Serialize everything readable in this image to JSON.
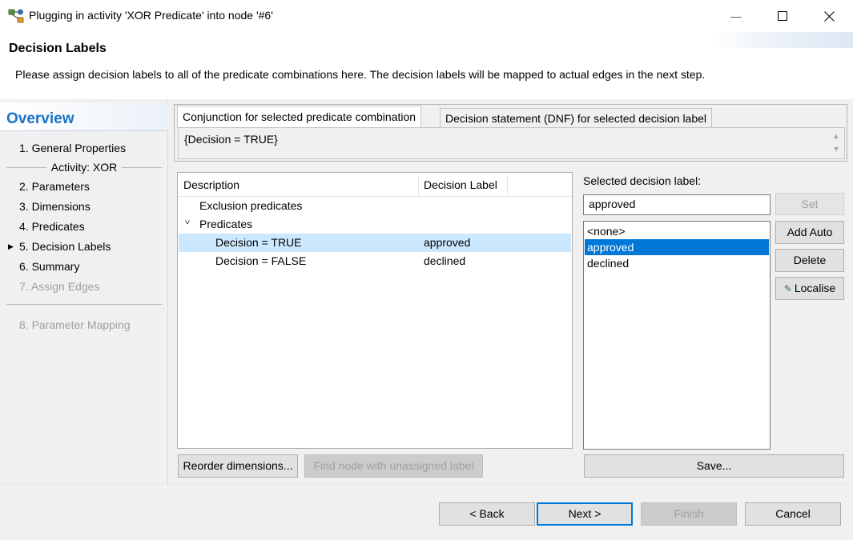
{
  "window": {
    "title": "Plugging in activity 'XOR Predicate' into node '#6'",
    "icon": "workflow-node-icon",
    "minimize_glyph": "—",
    "maximize_glyph": "☐",
    "close_glyph": "✕"
  },
  "header": {
    "title": "Decision Labels",
    "description": "Please assign decision labels to all of the predicate combinations here. The decision labels will be mapped to actual edges in the next step."
  },
  "overview": {
    "title": "Overview",
    "items": [
      {
        "label": "1.  General Properties",
        "enabled": true
      },
      {
        "label": "2.  Parameters",
        "enabled": true
      },
      {
        "label": "3.  Dimensions",
        "enabled": true
      },
      {
        "label": "4.  Predicates",
        "enabled": true
      },
      {
        "label": "5.  Decision Labels",
        "enabled": true,
        "current": true
      },
      {
        "label": "6.  Summary",
        "enabled": true
      },
      {
        "label": "7.  Assign Edges",
        "enabled": false
      },
      {
        "label": "8.  Parameter Mapping",
        "enabled": false
      }
    ],
    "activity_group": "Activity: XOR",
    "current_marker": "▶"
  },
  "tabs": {
    "items": [
      {
        "label": "Conjunction for selected predicate combination",
        "active": true
      },
      {
        "label": "Decision statement (DNF) for selected decision label",
        "active": false
      }
    ],
    "content": "{Decision = TRUE}",
    "scroll_up": "▲",
    "scroll_down": "▼"
  },
  "tree": {
    "columns": [
      "Description",
      "Decision Label"
    ],
    "rows": [
      {
        "description": "Exclusion predicates",
        "label": "",
        "level": 0,
        "expander": ""
      },
      {
        "description": "Predicates",
        "label": "",
        "level": 0,
        "expander": "v"
      },
      {
        "description": "Decision = TRUE",
        "label": "approved",
        "level": 1,
        "selected": true
      },
      {
        "description": "Decision = FALSE",
        "label": "declined",
        "level": 1,
        "selected": false
      }
    ]
  },
  "buttons": {
    "reorder": "Reorder dimensions...",
    "find_node": "Find node with unassigned label",
    "set": "Set",
    "add_auto": "Add Auto",
    "delete": "Delete",
    "localise": "Localise",
    "save": "Save...",
    "back": "< Back",
    "next": "Next >",
    "finish": "Finish",
    "cancel": "Cancel"
  },
  "decision_label": {
    "caption": "Selected decision label:",
    "value": "approved",
    "options": [
      "<none>",
      "approved",
      "declined"
    ],
    "selected_option": "approved"
  },
  "colors": {
    "accent": "#0078d7",
    "overview_title": "#1a73c9",
    "tree_selection": "#cce8ff"
  }
}
